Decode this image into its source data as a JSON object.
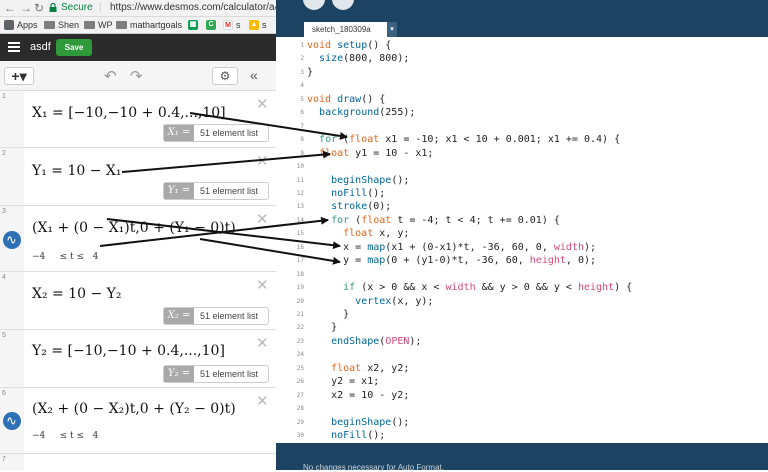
{
  "browser": {
    "secure_label": "Secure",
    "url": "https://www.desmos.com/calculator/a4c",
    "bookmarks": [
      "Apps",
      "Shen",
      "WP",
      "mathartgoals",
      "s",
      "s"
    ]
  },
  "desmos": {
    "graph_title": "asdf",
    "save_label": "Save",
    "add_label": "+▾",
    "expressions": [
      {
        "index": "1",
        "latex": "X₁ = [−10,−10 + 0.4,...,10]",
        "eval_var": "X₁ =",
        "eval_text": "51 element list"
      },
      {
        "index": "2",
        "latex": "Y₁ = 10 − X₁",
        "eval_var": "Y₁ =",
        "eval_text": "51 element list"
      },
      {
        "index": "3",
        "latex": "(X₁ + (0 − X₁)t,0 + (Y₁ − 0)t)",
        "domain_min": "−4",
        "domain_mid": "≤ t ≤",
        "domain_max": "4"
      },
      {
        "index": "4",
        "latex": "X₂ = 10 − Y₂",
        "eval_var": "X₂ =",
        "eval_text": "51 element list"
      },
      {
        "index": "5",
        "latex": "Y₂ = [−10,−10 + 0.4,...,10]",
        "eval_var": "Y₂ =",
        "eval_text": "51 element list"
      },
      {
        "index": "6",
        "latex": "(X₂ + (0 − X₂)t,0 + (Y₂ − 0)t)",
        "domain_min": "−4",
        "domain_mid": "≤ t ≤",
        "domain_max": "4"
      },
      {
        "index": "7"
      }
    ]
  },
  "processing": {
    "tab_name": "sketch_180309a",
    "line_numbers": [
      "1",
      "2",
      "3",
      "4",
      "5",
      "6",
      "7",
      "8",
      "9",
      "10",
      "11",
      "12",
      "13",
      "14",
      "15",
      "16",
      "17",
      "18",
      "19",
      "20",
      "21",
      "22",
      "23",
      "24",
      "25",
      "26",
      "27",
      "28",
      "29",
      "30"
    ],
    "code_lines": [
      "void setup() {",
      "  size(800, 800);",
      "}",
      "",
      "void draw() {",
      "  background(255);",
      "",
      "  for (float x1 = -10; x1 < 10 + 0.001; x1 += 0.4) {",
      "  float y1 = 10 - x1;",
      "",
      "    beginShape();",
      "    noFill();",
      "    stroke(0);",
      "    for (float t = -4; t < 4; t += 0.01) {",
      "      float x, y;",
      "      x = map(x1 + (0-x1)*t, -36, 60, 0, width);",
      "      y = map(0 + (y1-0)*t, -36, 60, height, 0);",
      "",
      "      if (x > 0 && x < width && y > 0 && y < height) {",
      "        vertex(x, y);",
      "      }",
      "    }",
      "    endShape(OPEN);",
      "",
      "    float x2, y2;",
      "    y2 = x1;",
      "    x2 = 10 - y2;",
      "",
      "    beginShape();",
      "    noFill();"
    ],
    "status_message": "No changes necessary for Auto Format."
  },
  "colors": {
    "processing_bg": "#1c4362",
    "desmos_topbar": "#2b2b2b",
    "save_green": "#2f9a3a",
    "param_blue": "#2d70b3"
  }
}
